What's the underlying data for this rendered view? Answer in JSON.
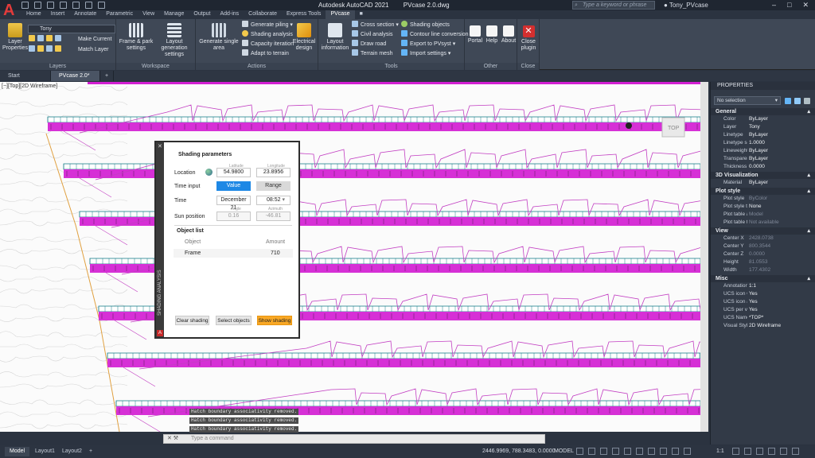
{
  "app": {
    "title": "Autodesk AutoCAD 2021",
    "file": "PVcase 2.0.dwg",
    "search_placeholder": "Type a keyword or phrase",
    "user": "Tony_PVcase"
  },
  "ribbon_tabs": [
    "Home",
    "Insert",
    "Annotate",
    "Parametric",
    "View",
    "Manage",
    "Output",
    "Add-ins",
    "Collaborate",
    "Express Tools",
    "PVcase"
  ],
  "active_tab": "PVcase",
  "ribbon": {
    "layers": {
      "title": "Layers",
      "layer_properties": "Layer Properties",
      "current_layer": "Tony",
      "make_current": "Make Current",
      "match_layer": "Match Layer"
    },
    "workspace": {
      "title": "Workspace",
      "frame_park": "Frame & park settings",
      "layout_generation": "Layout generation settings"
    },
    "actions": {
      "title": "Actions",
      "generate_single_area": "Generate single area",
      "generate_piling": "Generate piling",
      "shading_analysis": "Shading analysis",
      "capacity_iteration": "Capacity iteration",
      "adapt_to_terrain": "Adapt to terrain",
      "electrical_design": "Electrical design"
    },
    "tools": {
      "title": "Tools",
      "layout_information": "Layout information",
      "cross_section": "Cross section",
      "civil_analysis": "Civil analysis",
      "draw_road": "Draw road",
      "terrain_mesh": "Terrain mesh",
      "shading_objects": "Shading objects",
      "contour_line_conversion": "Contour line conversion",
      "export_to_pvsyst": "Export to PVsyst",
      "import_settings": "Import settings"
    },
    "other": {
      "title": "Other",
      "portal": "Portal",
      "help": "Help",
      "about": "About"
    },
    "close": {
      "title": "Close",
      "close_plugin": "Close plugin"
    }
  },
  "doc_tabs": [
    "Start",
    "PVcase 2.0*"
  ],
  "viewport_label": "[−][Top][2D Wireframe]",
  "viewcube_label": "TOP",
  "shading_dialog": {
    "side_title": "SHADING ANALYSIS",
    "heading": "Shading parameters",
    "location_label": "Location",
    "latitude_caption": "Latitude",
    "longitude_caption": "Longitude",
    "latitude": "54.9800",
    "longitude": "23.8956",
    "time_input_label": "Time input",
    "value_btn": "Value",
    "range_btn": "Range",
    "time_label": "Time",
    "date": "December 21",
    "time": "08:52",
    "sun_position_label": "Sun position",
    "angle_caption": "Angle",
    "azimuth_caption": "Azimuth",
    "angle": "0.16",
    "azimuth": "-46.81",
    "object_list_heading": "Object list",
    "col_object": "Object",
    "col_amount": "Amount",
    "rows": [
      {
        "object": "Frame",
        "amount": "710"
      }
    ],
    "clear_btn": "Clear shading",
    "select_btn": "Select objects",
    "show_btn": "Show shading"
  },
  "command": {
    "messages": [
      "Hatch boundary associativity removed.",
      "Hatch boundary associativity removed.",
      "Hatch boundary associativity removed."
    ],
    "placeholder": "Type a command"
  },
  "status": {
    "layout_tabs": [
      "Model",
      "Layout1",
      "Layout2"
    ],
    "coords": "2446.9969, 788.3483, 0.0000",
    "mode": "MODEL",
    "scale": "1:1"
  },
  "properties": {
    "title": "PROPERTIES",
    "selection": "No selection",
    "sections": [
      {
        "name": "General",
        "rows": [
          {
            "k": "Color",
            "v": "ByLayer"
          },
          {
            "k": "Layer",
            "v": "Tony"
          },
          {
            "k": "Linetype",
            "v": "ByLayer"
          },
          {
            "k": "Linetype scale",
            "v": "1.0000"
          },
          {
            "k": "Lineweight",
            "v": "ByLayer"
          },
          {
            "k": "Transparency",
            "v": "ByLayer"
          },
          {
            "k": "Thickness",
            "v": "0.0000"
          }
        ]
      },
      {
        "name": "3D Visualization",
        "rows": [
          {
            "k": "Material",
            "v": "ByLayer"
          }
        ]
      },
      {
        "name": "Plot style",
        "rows": [
          {
            "k": "Plot style",
            "v": "ByColor",
            "dim": true
          },
          {
            "k": "Plot style table",
            "v": "None"
          },
          {
            "k": "Plot table att...",
            "v": "Model",
            "dim": true
          },
          {
            "k": "Plot table type",
            "v": "Not available",
            "dim": true
          }
        ]
      },
      {
        "name": "View",
        "rows": [
          {
            "k": "Center X",
            "v": "2428.0738",
            "dim": true
          },
          {
            "k": "Center Y",
            "v": "800.3544",
            "dim": true
          },
          {
            "k": "Center Z",
            "v": "0.0000",
            "dim": true
          },
          {
            "k": "Height",
            "v": "81.0553",
            "dim": true
          },
          {
            "k": "Width",
            "v": "177.4302",
            "dim": true
          }
        ]
      },
      {
        "name": "Misc",
        "rows": [
          {
            "k": "Annotation s...",
            "v": "1:1"
          },
          {
            "k": "UCS icon On",
            "v": "Yes"
          },
          {
            "k": "UCS icon at...",
            "v": "Yes"
          },
          {
            "k": "UCS per view...",
            "v": "Yes"
          },
          {
            "k": "UCS Name",
            "v": "*TOP*"
          },
          {
            "k": "Visual Style",
            "v": "2D Wireframe"
          }
        ]
      }
    ]
  }
}
